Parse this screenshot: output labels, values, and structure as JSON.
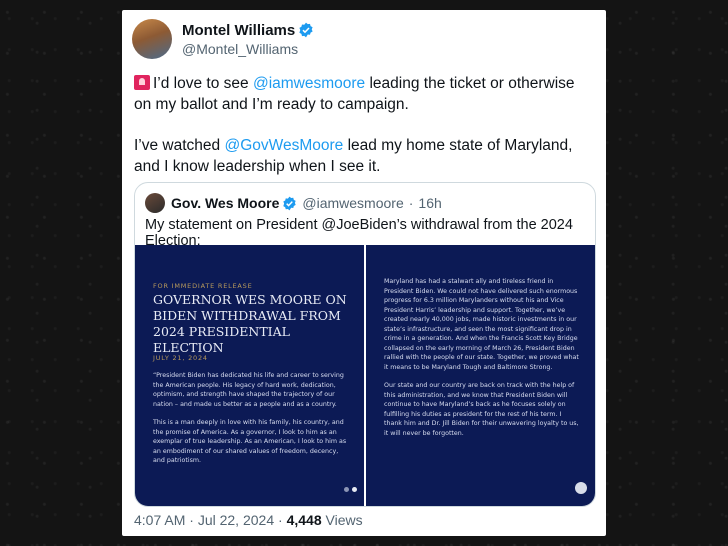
{
  "tweet": {
    "display_name": "Montel Williams",
    "handle": "@Montel_Williams",
    "paragraph1_pre": "I’d love to see ",
    "mention1": "@iamwesmoore",
    "paragraph1_post": " leading the ticket or otherwise on my ballot and I’m ready to campaign.",
    "paragraph2_pre": "I’ve watched ",
    "mention2": "@GovWesMoore",
    "paragraph2_post": " lead my home state of Maryland, and I know leadership when I see it.",
    "emoji_icon": "rotating-light-icon"
  },
  "quote": {
    "display_name": "Gov. Wes Moore",
    "handle": "@iamwesmoore",
    "separator": "·",
    "age": "16h",
    "text": "My statement on President @JoeBiden’s withdrawal from the 2024 Election:"
  },
  "media": {
    "left": {
      "release": "FOR IMMEDIATE RELEASE",
      "headline": "GOVERNOR WES MOORE ON BIDEN WITHDRAWAL FROM 2024 PRESIDENTIAL ELECTION",
      "date": "JULY 21, 2024",
      "para1": "“President Biden has dedicated his life and career to serving the American people. His legacy of hard work, dedication, optimism, and strength have shaped the trajectory of our nation – and made us better as a people and as a country.",
      "para2": "This is a man deeply in love with his family, his country, and the promise of America. As a governor, I look to him as an exemplar of true leadership. As an American, I look to him as an embodiment of our shared values of freedom, decency, and patriotism."
    },
    "right": {
      "para1": "Maryland has had a stalwart ally and tireless friend in President Biden. We could not have delivered such enormous progress for 6.3 million Marylanders without his and Vice President Harris’ leadership and support. Together, we’ve created nearly 40,000 jobs, made historic investments in our state’s infrastructure, and seen the most significant drop in crime in a generation. And when the Francis Scott Key Bridge collapsed on the early morning of March 26, President Biden rallied with the people of our state. Together, we proved what it means to be Maryland Tough and Baltimore Strong.",
      "para2": "Our state and our country are back on track with the help of this administration, and we know that President Biden will continue to have Maryland’s back as he focuses solely on fulfilling his duties as president for the rest of his term. I thank him and Dr. Jill Biden for their unwavering loyalty to us, it will never be forgotten."
    }
  },
  "footer": {
    "time": "4:07 AM",
    "separator": "·",
    "date": "Jul 22, 2024",
    "views_count": "4,448",
    "views_label": "Views"
  },
  "colors": {
    "accent": "#1d9bf0",
    "statement_bg": "#0c1a55"
  }
}
